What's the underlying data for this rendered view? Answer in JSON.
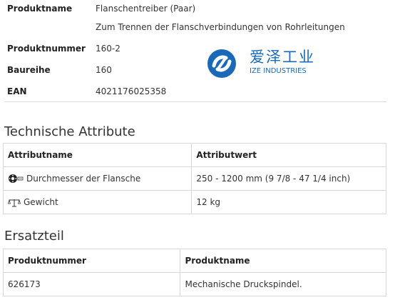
{
  "product": {
    "name_label": "Produktname",
    "name_value": "Flanschentreiber (Paar)",
    "description": "Zum Trennen der Flanschverbindungen von Rohrleitungen",
    "number_label": "Produktnummer",
    "number_value": "160-2",
    "series_label": "Baureihe",
    "series_value": "160",
    "ean_label": "EAN",
    "ean_value": "4021176025358"
  },
  "logo": {
    "chinese": "爱泽工业",
    "english": "IZE INDUSTRIES",
    "color": "#1a68b8"
  },
  "technical": {
    "title": "Technische Attribute",
    "col_name": "Attributname",
    "col_value": "Attributwert",
    "rows": [
      {
        "name": "Durchmesser der Flansche",
        "value": "250 - 1200 mm (9 7/8 - 47 1/4 inch)",
        "icon": "flange-diameter-icon"
      },
      {
        "name": "Gewicht",
        "value": "12 kg",
        "icon": "weight-scale-icon"
      }
    ]
  },
  "spare_parts": {
    "title": "Ersatzteil",
    "col_number": "Produktnummer",
    "col_name": "Produktname",
    "rows": [
      {
        "number": "626173",
        "name": "Mechanische Druckspindel."
      }
    ]
  }
}
